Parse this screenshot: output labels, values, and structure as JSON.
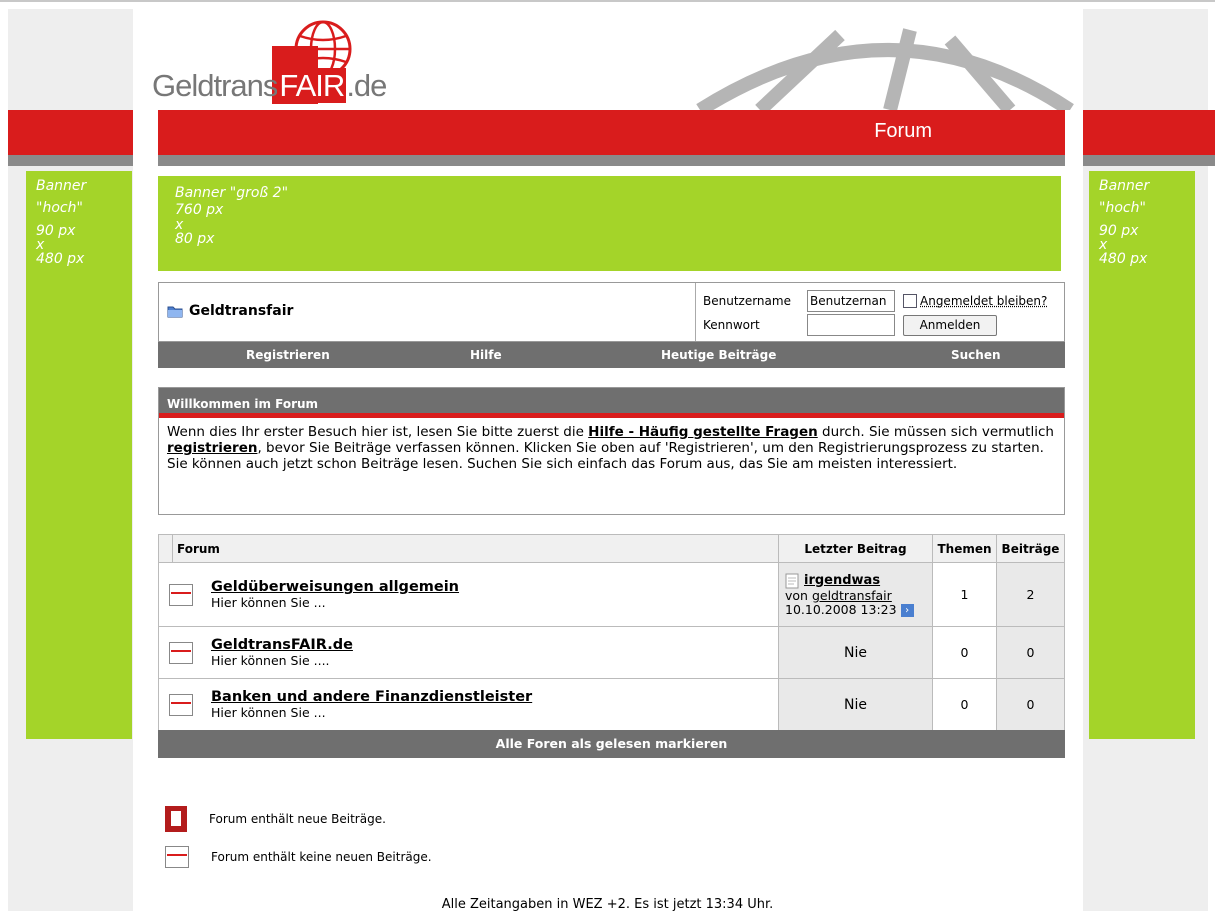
{
  "logo": {
    "text_main": "Geldtrans",
    "text_fair": "FAIR",
    "text_tld": ".de"
  },
  "header": {
    "forum_title": "Forum"
  },
  "banners": {
    "left": [
      "Banner",
      "\"hoch\"",
      "90 px",
      "x",
      "480 px"
    ],
    "right": [
      "Banner",
      "\"hoch\"",
      "90 px",
      "x",
      "480 px"
    ],
    "main": [
      "Banner \"groß 2\"",
      "760 px",
      "x",
      "80 px"
    ]
  },
  "site": {
    "name": "Geldtransfair"
  },
  "login": {
    "username_label": "Benutzername",
    "username_value": "Benutzernan",
    "remember_label": "Angemeldet bleiben?",
    "password_label": "Kennwort",
    "password_value": "",
    "submit_label": "Anmelden"
  },
  "navbar": {
    "register": "Registrieren",
    "help": "Hilfe",
    "today": "Heutige Beiträge",
    "search": "Suchen"
  },
  "welcome": {
    "title": "Willkommen im Forum",
    "text_1": "Wenn dies Ihr erster Besuch hier ist, lesen Sie bitte zuerst die ",
    "faq_link": "Hilfe - Häufig gestellte Fragen",
    "text_2": " durch. Sie müssen sich vermutlich ",
    "register_link": "registrieren",
    "text_3": ", bevor Sie Beiträge verfassen können. Klicken Sie oben auf 'Registrieren', um den Registrierungsprozess zu starten. Sie können auch jetzt schon Beiträge lesen. Suchen Sie sich einfach das Forum aus, das Sie am meisten interessiert."
  },
  "forum_table": {
    "headers": {
      "forum": "Forum",
      "last_post": "Letzter Beitrag",
      "threads": "Themen",
      "posts": "Beiträge"
    },
    "rows": [
      {
        "title": "Geldüberweisungen allgemein",
        "desc": "Hier können Sie ...",
        "last_title": "irgendwas",
        "last_by_prefix": "von ",
        "last_by": "geldtransfair",
        "last_date": "10.10.2008 13:23",
        "threads": "1",
        "posts": "2"
      },
      {
        "title": "GeldtransFAIR.de",
        "desc": "Hier können Sie ....",
        "last": "Nie",
        "threads": "0",
        "posts": "0"
      },
      {
        "title": "Banken und andere Finanzdienstleister",
        "desc": "Hier können Sie ...",
        "last": "Nie",
        "threads": "0",
        "posts": "0"
      }
    ],
    "mark_read": "Alle Foren als gelesen markieren"
  },
  "legend": {
    "new_posts": "Forum enthält neue Beiträge.",
    "no_new_posts": "Forum enthält keine neuen Beiträge."
  },
  "footer": {
    "time_text": "Alle Zeitangaben in WEZ +2. Es ist jetzt 13:34 Uhr."
  },
  "colors": {
    "red": "#d91c1c",
    "green": "#a4d429",
    "grey": "#6f6f6f"
  }
}
